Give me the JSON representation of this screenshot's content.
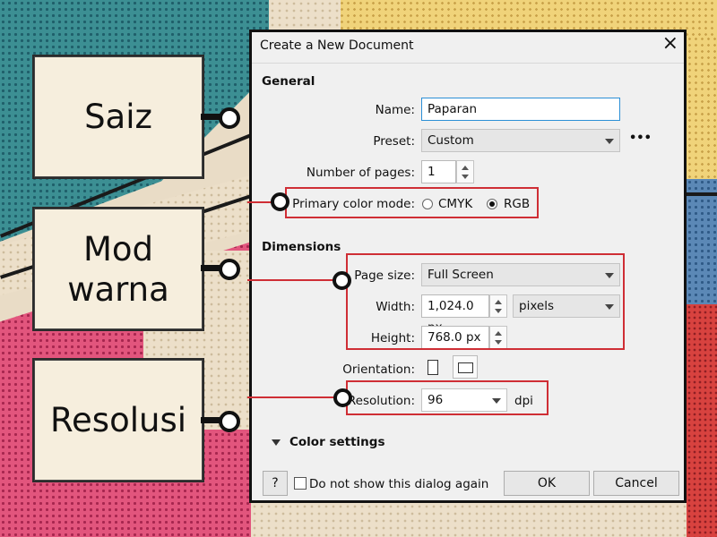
{
  "labels": {
    "size": "Saiz",
    "color_mode": [
      "Mod",
      "warna"
    ],
    "resolution": "Resolusi"
  },
  "dialog": {
    "title": "Create a New Document",
    "close_icon": "×",
    "general": {
      "heading": "General",
      "name_label": "Name:",
      "name_value": "Paparan",
      "preset_label": "Preset:",
      "preset_value": "Custom",
      "more_icon": "•••",
      "pages_label": "Number of pages:",
      "pages_value": "1",
      "color_mode_label": "Primary color mode:",
      "color_modes": [
        "CMYK",
        "RGB"
      ],
      "color_mode_selected": "RGB"
    },
    "dimensions": {
      "heading": "Dimensions",
      "page_size_label": "Page size:",
      "page_size_value": "Full Screen",
      "width_label": "Width:",
      "width_value": "1,024.0 px",
      "units_value": "pixels",
      "height_label": "Height:",
      "height_value": "768.0 px",
      "orientation_label": "Orientation:",
      "resolution_label": "Resolution:",
      "resolution_value": "96",
      "resolution_unit": "dpi"
    },
    "color_settings": "Color settings",
    "help_label": "?",
    "dont_show_label": "Do not show this dialog again",
    "ok_label": "OK",
    "cancel_label": "Cancel"
  },
  "colors": {
    "highlight": "#cf2e35",
    "focus": "#2b8fd6"
  }
}
